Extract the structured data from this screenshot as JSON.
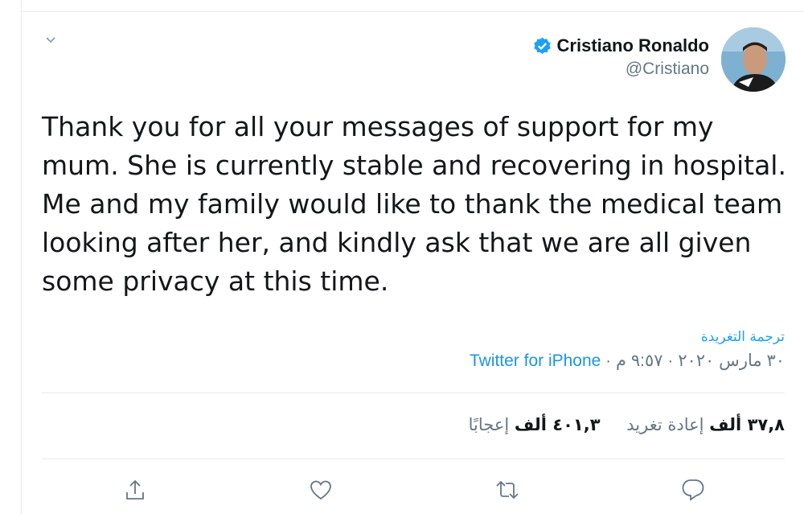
{
  "tweet": {
    "author_name": "Cristiano Ronaldo",
    "author_handle": "@Cristiano",
    "text": "Thank you for all your messages of support for my mum. She is currently stable and recovering in hospital. Me and my family would like to thank the medical team looking after her, and kindly ask that we are all given some privacy at this time.",
    "translate_label": "ترجمة التغريدة",
    "time": "٩:٥٧ م",
    "date": "٣٠ مارس ٢٠٢٠",
    "source": "Twitter for iPhone",
    "separator": " · "
  },
  "stats": {
    "retweets_count": "٣٧,٨ ألف",
    "retweets_label": "إعادة تغريد",
    "likes_count": "٤٠١,٣ ألف",
    "likes_label": "إعجابًا"
  },
  "colors": {
    "accent": "#1da1f2",
    "muted": "#657786",
    "divider": "#e6ecf0"
  },
  "icons": {
    "menu": "chevron-down-icon",
    "verified": "verified-badge-icon",
    "share": "share-icon",
    "like": "heart-icon",
    "retweet": "retweet-icon",
    "reply": "reply-icon"
  }
}
